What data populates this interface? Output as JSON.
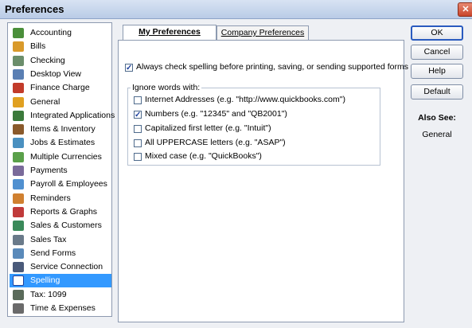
{
  "window": {
    "title": "Preferences",
    "close_glyph": "✕"
  },
  "sidebar": {
    "items": [
      {
        "label": "Accounting",
        "icon": "accounting-icon",
        "color": "#4a8f3a"
      },
      {
        "label": "Bills",
        "icon": "bills-icon",
        "color": "#d99a2b"
      },
      {
        "label": "Checking",
        "icon": "checking-icon",
        "color": "#6b8e6b"
      },
      {
        "label": "Desktop View",
        "icon": "desktop-view-icon",
        "color": "#5a7fb3"
      },
      {
        "label": "Finance Charge",
        "icon": "finance-charge-icon",
        "color": "#c23b2a"
      },
      {
        "label": "General",
        "icon": "general-icon",
        "color": "#e0a020"
      },
      {
        "label": "Integrated Applications",
        "icon": "integrated-applications-icon",
        "color": "#3b7a3b"
      },
      {
        "label": "Items & Inventory",
        "icon": "items-inventory-icon",
        "color": "#8a5a2b"
      },
      {
        "label": "Jobs & Estimates",
        "icon": "jobs-estimates-icon",
        "color": "#4a90c0"
      },
      {
        "label": "Multiple Currencies",
        "icon": "multiple-currencies-icon",
        "color": "#5aa04a"
      },
      {
        "label": "Payments",
        "icon": "payments-icon",
        "color": "#7a6a9a"
      },
      {
        "label": "Payroll & Employees",
        "icon": "payroll-employees-icon",
        "color": "#5090d0"
      },
      {
        "label": "Reminders",
        "icon": "reminders-icon",
        "color": "#d08030"
      },
      {
        "label": "Reports & Graphs",
        "icon": "reports-graphs-icon",
        "color": "#c03a3a"
      },
      {
        "label": "Sales & Customers",
        "icon": "sales-customers-icon",
        "color": "#3a8a5a"
      },
      {
        "label": "Sales Tax",
        "icon": "sales-tax-icon",
        "color": "#6a7a8a"
      },
      {
        "label": "Send Forms",
        "icon": "send-forms-icon",
        "color": "#5a8aba"
      },
      {
        "label": "Service Connection",
        "icon": "service-connection-icon",
        "color": "#4a5a7a"
      },
      {
        "label": "Spelling",
        "icon": "spelling-icon",
        "color": "#ffffff",
        "selected": true
      },
      {
        "label": "Tax: 1099",
        "icon": "tax-1099-icon",
        "color": "#5a6a5a"
      },
      {
        "label": "Time & Expenses",
        "icon": "time-expenses-icon",
        "color": "#6a6a6a"
      }
    ]
  },
  "tabs": {
    "my_preferences": "My Preferences",
    "company_preferences": "Company Preferences",
    "active": "my_preferences"
  },
  "panel": {
    "always_check": {
      "label": "Always check spelling before printing, saving, or sending supported forms",
      "checked": true
    },
    "ignore_group": {
      "title": "Ignore words with:",
      "options": [
        {
          "label": "Internet Addresses (e.g. \"http://www.quickbooks.com\")",
          "checked": false
        },
        {
          "label": "Numbers (e.g. \"12345\" and \"QB2001\")",
          "checked": true
        },
        {
          "label": "Capitalized first letter (e.g. \"Intuit\")",
          "checked": false
        },
        {
          "label": "All UPPERCASE letters (e.g. \"ASAP\")",
          "checked": false
        },
        {
          "label": "Mixed case (e.g. \"QuickBooks\")",
          "checked": false
        }
      ]
    }
  },
  "buttons": {
    "ok": "OK",
    "cancel": "Cancel",
    "help": "Help",
    "default": "Default"
  },
  "also_see": {
    "title": "Also See:",
    "links": [
      "General"
    ]
  },
  "colors": {
    "selection": "#3399ff",
    "check_mark": "#1c3f9c"
  }
}
